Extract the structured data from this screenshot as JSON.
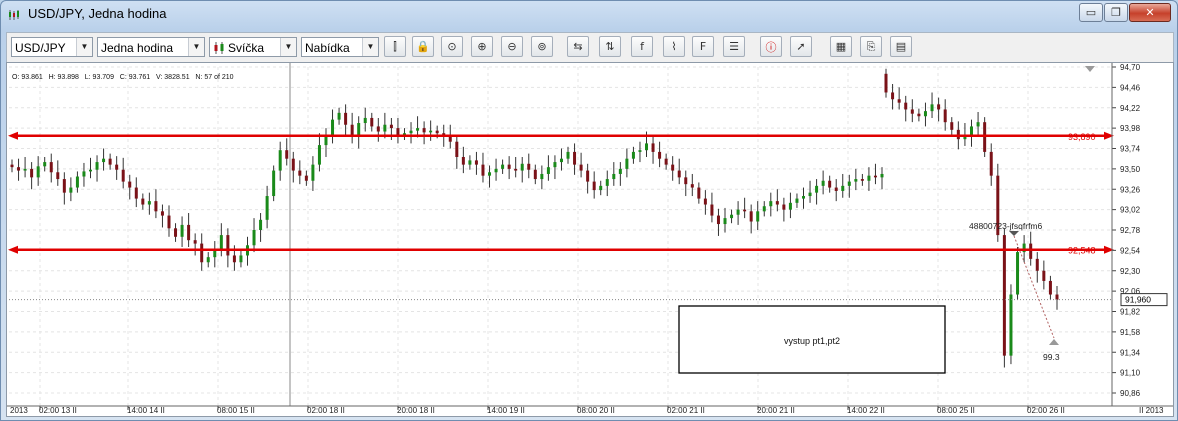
{
  "window": {
    "title": "USD/JPY,  Jedna hodina",
    "buttons": {
      "minimize": "▭",
      "restore": "❐",
      "close": "✕"
    }
  },
  "toolbar": {
    "symbol": "USD/JPY",
    "timeframe": "Jedna hodina",
    "chart_type": "Svíčka",
    "offer": "Nabídka",
    "icons": [
      "period-separator-icon",
      "lock-icon",
      "zoom-fit-icon",
      "zoom-in-icon",
      "zoom-out-icon",
      "zoom-reset-icon",
      "shift-chart-icon",
      "y-axis-scale-icon",
      "function-icon",
      "indicator-icon",
      "formula-icon",
      "news-icon",
      "info-icon",
      "cursor-icon",
      "color-settings-icon",
      "save-template-icon",
      "properties-icon"
    ]
  },
  "ohlc_line": "O: 93.861   H: 93.898   L: 93.709   C: 93.761   V: 3828.51   N: 57 of 210",
  "colors": {
    "up": "#1a8a1a",
    "down": "#7a1218",
    "level": "#e00000",
    "grid": "#e4e4e4"
  },
  "chart_data": {
    "type": "candlestick",
    "title": "USD/JPY,  Jedna hodina",
    "ylim": [
      90.86,
      94.7
    ],
    "y_ticks": [
      "94,70",
      "94,46",
      "94,22",
      "93,98",
      "93,74",
      "93,50",
      "93,26",
      "93,02",
      "92,78",
      "92,54",
      "92,30",
      "92,06",
      "91,82",
      "91,58",
      "91,34",
      "91,10",
      "90,86"
    ],
    "x_ticks": [
      "2013",
      "02:00 13 II",
      "14:00 14 II",
      "08:00 15 II",
      "02:00 18 II",
      "20:00 18 II",
      "14:00 19 II",
      "08:00 20 II",
      "02:00 21 II",
      "20:00 21 II",
      "14:00 22 II",
      "08:00 25 II",
      "02:00 26 II",
      "II 2013"
    ],
    "grid": true,
    "series": [
      {
        "segment": 1,
        "close": [
          93.52,
          93.48,
          93.5,
          93.4,
          93.53,
          93.58,
          93.46,
          93.38,
          93.22,
          93.28,
          93.41,
          93.47,
          93.49,
          93.58,
          93.62,
          93.55,
          93.49,
          93.35,
          93.28,
          93.15,
          93.08,
          93.12,
          93.0,
          92.95,
          92.8,
          92.7,
          92.84,
          92.66,
          92.62,
          92.4,
          92.46,
          92.55,
          92.72,
          92.48,
          92.4,
          92.48,
          92.6,
          92.78,
          92.9,
          93.18,
          93.48,
          93.72,
          93.62,
          93.48,
          93.42,
          93.36,
          93.55,
          93.78,
          93.9,
          94.08,
          94.16,
          94.02,
          93.88,
          94.04,
          94.1,
          94.0,
          93.94,
          94.02,
          93.98,
          93.9,
          93.92,
          93.95,
          93.98,
          93.93,
          93.95,
          93.92,
          93.88,
          93.82,
          93.64,
          93.55,
          93.6,
          93.55,
          93.42,
          93.46,
          93.5,
          93.55,
          93.5,
          93.48,
          93.56,
          93.49,
          93.38,
          93.44,
          93.52,
          93.58,
          93.62,
          93.7,
          93.55,
          93.48,
          93.35,
          93.25,
          93.3,
          93.38,
          93.44,
          93.5,
          93.62,
          93.7,
          93.72,
          93.8,
          93.7,
          93.62,
          93.55,
          93.48,
          93.4,
          93.32,
          93.28,
          93.15,
          93.08,
          92.95,
          92.85,
          92.92,
          92.96,
          93.02,
          93.0,
          92.88,
          93.0,
          93.06,
          93.12,
          93.08,
          93.02,
          93.1,
          93.15,
          93.18,
          93.22,
          93.3,
          93.36,
          93.28,
          93.24,
          93.3,
          93.35,
          93.38,
          93.36,
          93.42,
          93.4,
          93.44
        ]
      },
      {
        "segment": 2,
        "close": [
          94.4,
          94.32,
          94.28,
          94.2,
          94.15,
          94.12,
          94.18,
          94.26,
          94.2,
          94.05,
          93.96,
          93.85,
          93.9,
          94.0,
          94.05,
          93.7,
          93.42,
          92.72,
          91.3,
          92.02,
          92.52,
          92.62,
          92.44,
          92.3,
          92.18,
          92.02,
          91.96
        ]
      }
    ],
    "levels": [
      {
        "value": 93.89,
        "label": "93,890"
      },
      {
        "value": 92.548,
        "label": "92,548"
      }
    ],
    "current_price": {
      "value": 91.96,
      "label": "91,960"
    },
    "annotations": {
      "order_label": "48800723-jfsqfrfm6",
      "target_label": "99.3",
      "textbox": "vystup pt1,pt2"
    }
  }
}
